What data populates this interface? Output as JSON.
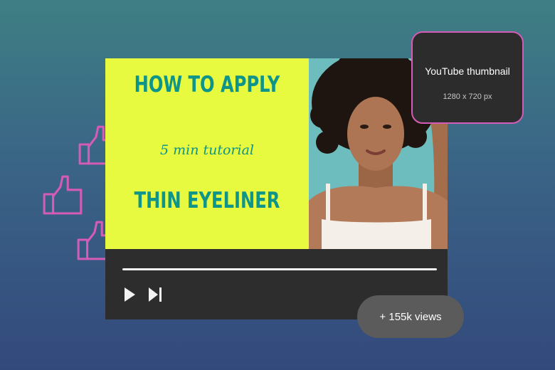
{
  "thumbnail": {
    "headline_top": "HOW TO APPLY",
    "subtitle": "5 min tutorial",
    "headline_bottom": "THIN EYELINER",
    "photo_description": "Portrait of a woman with curly hair in a white top"
  },
  "player": {
    "progress_fraction": 1.0,
    "controls": {
      "play_icon": "play-icon",
      "next_icon": "skip-next-icon"
    }
  },
  "info_card": {
    "title": "YouTube thumbnail",
    "size": "1280 x 720 px"
  },
  "views_badge": {
    "label": "+ 155k views"
  },
  "decor": {
    "like_icon": "thumbs-up-icon"
  },
  "colors": {
    "thumbnail_background": "#e8fa3f",
    "thumbnail_text": "#0e9488",
    "accent_outline": "#d45bb6",
    "player_bar": "#2d2d2d",
    "card_background": "#2c2c2c",
    "pill_background": "#5b5b5b"
  }
}
